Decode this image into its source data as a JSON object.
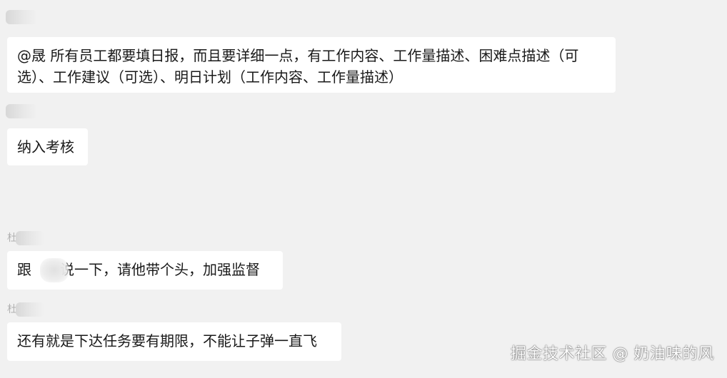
{
  "messages": [
    {
      "sender_hint": "",
      "lines": [
        "@晟 所有员工都要填日报，而且要详细一点，有工作内容、工作量描述、困难点描述（可",
        "选）、工作建议（可选）、明日计划（工作内容、工作量描述）"
      ]
    },
    {
      "sender_hint": "",
      "lines": [
        "纳入考核"
      ]
    },
    {
      "sender_hint": "杜",
      "lines": [
        "跟　　说一下，请他带个头，加强监督"
      ]
    },
    {
      "sender_hint": "杜",
      "lines": [
        "还有就是下达任务要有期限，不能让子弹一直飞"
      ]
    }
  ],
  "watermark": "掘金技术社区 @ 奶油味的风",
  "colors": {
    "background": "#f1f1f1",
    "bubble": "#ffffff",
    "text": "#191919"
  }
}
